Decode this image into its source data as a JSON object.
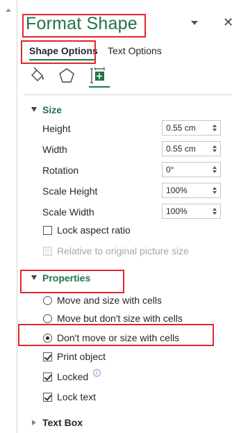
{
  "pane": {
    "title": "Format Shape",
    "tabs": [
      {
        "label": "Shape Options"
      },
      {
        "label": "Text Options"
      }
    ],
    "icons": [
      "fill-line-icon",
      "effects-pentagon-icon",
      "size-properties-icon"
    ]
  },
  "size": {
    "header": "Size",
    "rows": [
      {
        "label": "Height",
        "value": "0.55 cm"
      },
      {
        "label": "Width",
        "value": "0.55 cm"
      },
      {
        "label": "Rotation",
        "value": "0°"
      },
      {
        "label": "Scale Height",
        "value": "100%"
      },
      {
        "label": "Scale Width",
        "value": "100%"
      }
    ],
    "lock_aspect": {
      "label": "Lock aspect ratio",
      "checked": false
    },
    "relative_original": {
      "label": "Relative to original picture size",
      "checked": false,
      "disabled": true
    }
  },
  "properties": {
    "header": "Properties",
    "options": [
      {
        "label": "Move and size with cells",
        "selected": false
      },
      {
        "label": "Move but don't size with cells",
        "selected": false
      },
      {
        "label": "Don't move or size with cells",
        "selected": true
      }
    ],
    "print_object": {
      "label": "Print object",
      "checked": true
    },
    "locked": {
      "label": "Locked",
      "checked": true
    },
    "lock_text": {
      "label": "Lock text",
      "checked": true
    }
  },
  "textbox": {
    "header": "Text Box"
  },
  "colors": {
    "accent": "#217346",
    "highlight": "#e0262b"
  }
}
